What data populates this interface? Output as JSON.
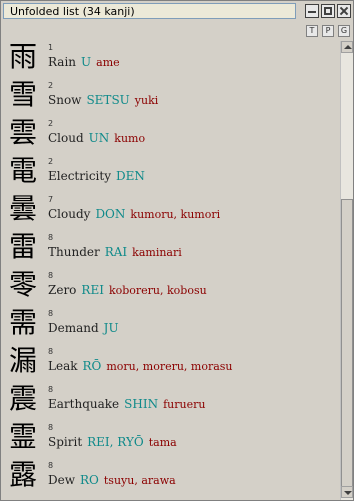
{
  "window": {
    "title": "Unfolded list  (34 kanji)"
  },
  "toolbar": {
    "t_label": "T",
    "p_label": "P",
    "g_label": "G"
  },
  "items": [
    {
      "kanji": "雨",
      "strokes": "1",
      "meaning": "Rain",
      "on": "U",
      "kun": "ame"
    },
    {
      "kanji": "雪",
      "strokes": "2",
      "meaning": "Snow",
      "on": "SETSU",
      "kun": "yuki"
    },
    {
      "kanji": "雲",
      "strokes": "2",
      "meaning": "Cloud",
      "on": "UN",
      "kun": "kumo"
    },
    {
      "kanji": "電",
      "strokes": "2",
      "meaning": "Electricity",
      "on": "DEN",
      "kun": ""
    },
    {
      "kanji": "曇",
      "strokes": "7",
      "meaning": "Cloudy",
      "on": "DON",
      "kun": "kumoru, kumori"
    },
    {
      "kanji": "雷",
      "strokes": "8",
      "meaning": "Thunder",
      "on": "RAI",
      "kun": "kaminari"
    },
    {
      "kanji": "零",
      "strokes": "8",
      "meaning": "Zero",
      "on": "REI",
      "kun": "koboreru, kobosu"
    },
    {
      "kanji": "需",
      "strokes": "8",
      "meaning": "Demand",
      "on": "JU",
      "kun": ""
    },
    {
      "kanji": "漏",
      "strokes": "8",
      "meaning": "Leak",
      "on": "RŌ",
      "kun": "moru, moreru, morasu"
    },
    {
      "kanji": "震",
      "strokes": "8",
      "meaning": "Earthquake",
      "on": "SHIN",
      "kun": "furueru"
    },
    {
      "kanji": "霊",
      "strokes": "8",
      "meaning": "Spirit",
      "on": "REI, RYŌ",
      "kun": "tama"
    },
    {
      "kanji": "露",
      "strokes": "8",
      "meaning": "Dew",
      "on": "RO",
      "kun": "tsuyu, arawa"
    }
  ]
}
